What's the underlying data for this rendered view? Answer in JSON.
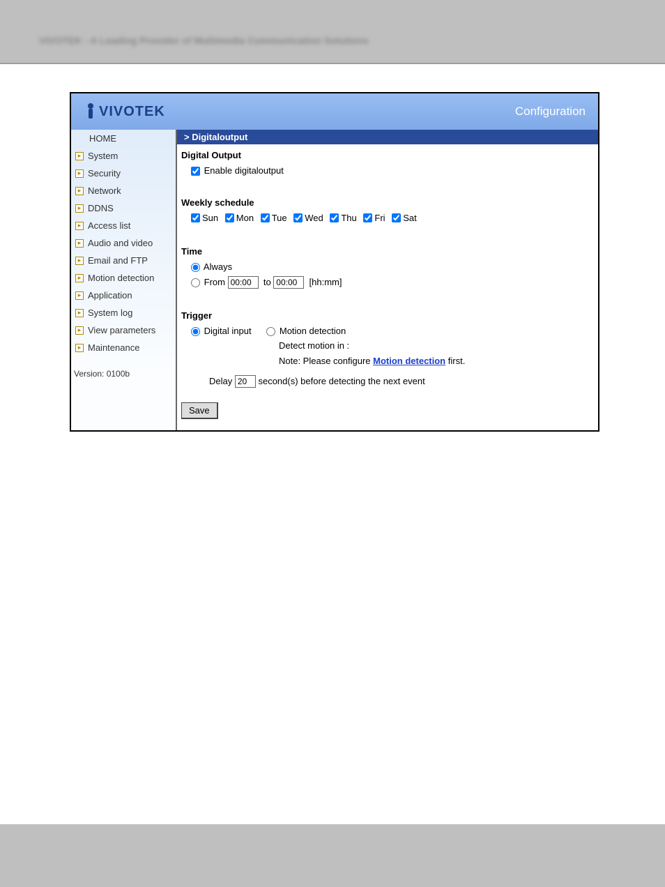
{
  "topBlur": "VIVOTEK - A Leading Provider of Multimedia Communication Solutions",
  "logo": "VIVOTEK",
  "configTitle": "Configuration",
  "sidebar": {
    "home": "HOME",
    "items": [
      "System",
      "Security",
      "Network",
      "DDNS",
      "Access list",
      "Audio and video",
      "Email and FTP",
      "Motion detection",
      "Application",
      "System log",
      "View parameters",
      "Maintenance"
    ]
  },
  "version": "Version: 0100b",
  "breadcrumb": "> Digitaloutput",
  "sections": {
    "digitalOutput": {
      "title": "Digital Output",
      "enableLabel": "Enable digitaloutput",
      "enableChecked": true
    },
    "weekly": {
      "title": "Weekly schedule",
      "days": [
        "Sun",
        "Mon",
        "Tue",
        "Wed",
        "Thu",
        "Fri",
        "Sat"
      ]
    },
    "time": {
      "title": "Time",
      "alwaysLabel": "Always",
      "fromLabel": "From",
      "toLabel": "to",
      "hint": "[hh:mm]",
      "fromValue": "00:00",
      "toValue": "00:00",
      "selected": "always"
    },
    "trigger": {
      "title": "Trigger",
      "digitalInputLabel": "Digital input",
      "motionDetectLabel": "Motion detection",
      "detectMotionIn": "Detect motion in :",
      "notePrefix": "Note: Please configure ",
      "motionLink": "Motion detection",
      "noteSuffix": " first.",
      "delayPrefix": "Delay ",
      "delayValue": "20",
      "delaySuffix": " second(s) before detecting the next event"
    }
  },
  "saveLabel": "Save"
}
